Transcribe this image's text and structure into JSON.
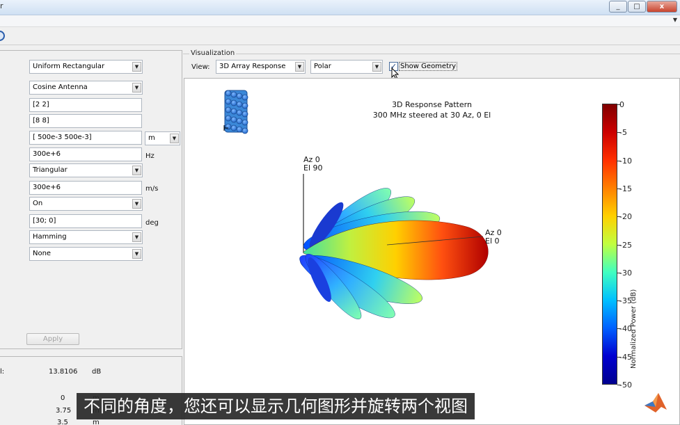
{
  "window": {
    "title_fragment": "r",
    "buttons": [
      "_",
      "□",
      "x"
    ]
  },
  "left": {
    "array_geometry": "Uniform Rectangular",
    "element_type": "Cosine Antenna",
    "size": "[2 2]",
    "element_spacing_num": "[8  8]",
    "spacing": "[ 500e-3 500e-3]",
    "spacing_unit": "m",
    "frequency": "300e+6",
    "frequency_unit": "Hz",
    "lattice": "Triangular",
    "propagation_speed": "300e+6",
    "speed_unit": "m/s",
    "steering": "On",
    "steering_angle": "[30; 0]",
    "angle_unit": "deg",
    "taper": "Hamming",
    "quantize": "None",
    "apply_label": "Apply"
  },
  "results": {
    "directivity_label_fragment": "l:",
    "directivity_value": "13.8106",
    "directivity_unit": "dB",
    "values": [
      "0",
      "3.75",
      "3.5"
    ],
    "row_units": [
      "m",
      "m",
      "m"
    ]
  },
  "viz": {
    "legend": "Visualization",
    "view_label": "View:",
    "view_selected": "3D Array Response",
    "plot_type": "Polar",
    "show_geometry_label": "Show Geometry",
    "show_geometry_checked": "✓"
  },
  "chart_data": {
    "type": "3d-polar-response",
    "title": "3D Response Pattern",
    "subtitle": "300 MHz steered at 30 Az, 0 El",
    "axis_label_top": "Az 0\nEl 90",
    "axis_label_side": "Az 0\nEl 0",
    "colorbar": {
      "label": "Normalized Power (dB)",
      "ticks": [
        "0",
        "-5",
        "-10",
        "-15",
        "-20",
        "-25",
        "-30",
        "-35",
        "-40",
        "-45",
        "-50"
      ],
      "range": [
        -50,
        0
      ]
    },
    "colors": {
      "main_lobe": "#cc1a00",
      "side_lobe": "#2a9fff"
    }
  },
  "subtitle": "不同的角度，您还可以显示几何图形并旋转两个视图"
}
